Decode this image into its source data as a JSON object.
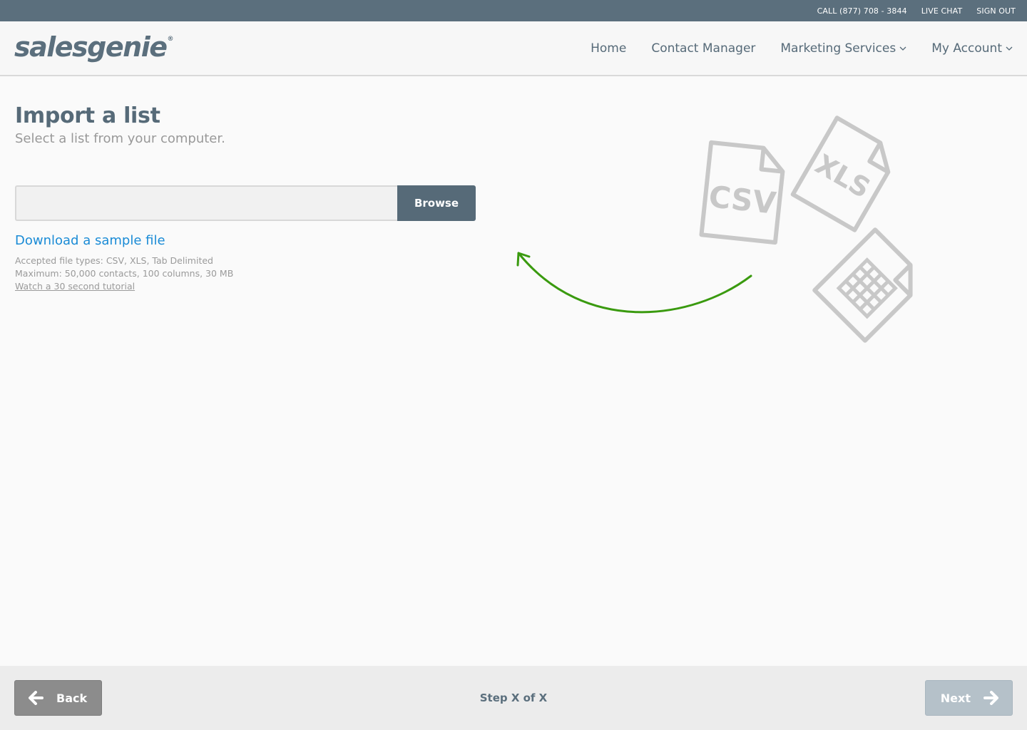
{
  "utility": {
    "phone": "CALL (877) 708 - 3844",
    "live_chat": "LIVE CHAT",
    "sign_out": "SIGN OUT"
  },
  "header": {
    "logo": "salesgenie",
    "logo_mark": "®",
    "nav": {
      "home": "Home",
      "contact_manager": "Contact Manager",
      "marketing_services": "Marketing Services",
      "my_account": "My Account"
    }
  },
  "main": {
    "title": "Import a list",
    "subtitle": "Select a list from your computer.",
    "file_input": {
      "value": "",
      "placeholder": ""
    },
    "browse_label": "Browse",
    "sample_link": "Download a sample file",
    "accepted_types": "Accepted file types: CSV, XLS, Tab Delimited",
    "maximum": "Maximum: 50,000 contacts, 100 columns, 30 MB",
    "tutorial_link": "Watch a 30 second tutorial"
  },
  "illustration": {
    "csv_label": "CSV",
    "xls_label": "XLS",
    "arrow_color": "#3a9a0f",
    "icon_color": "#c8c8c8"
  },
  "footer": {
    "back_label": "Back",
    "step_text": "Step X of X",
    "next_label": "Next"
  },
  "colors": {
    "accent": "#566a78",
    "link": "#1a8bd6",
    "utility_bar": "#5b6f7d"
  }
}
